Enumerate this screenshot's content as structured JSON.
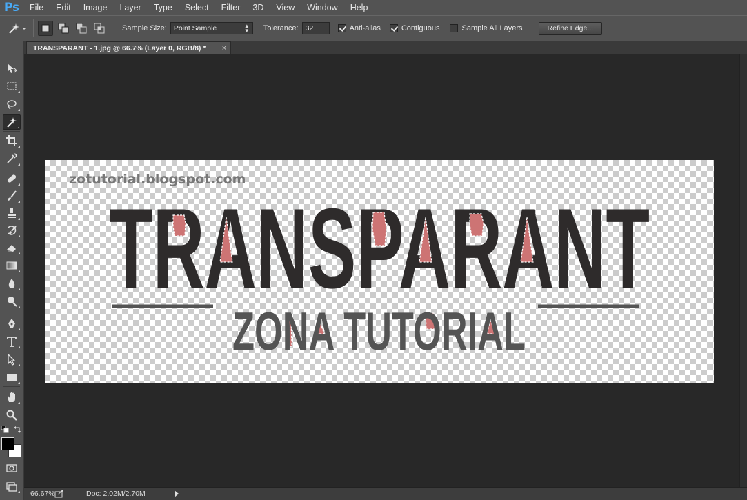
{
  "app": {
    "logo": "Ps"
  },
  "menu": [
    "File",
    "Edit",
    "Image",
    "Layer",
    "Type",
    "Select",
    "Filter",
    "3D",
    "View",
    "Window",
    "Help"
  ],
  "options": {
    "tool_icon": "magic-wand-icon",
    "selection_modes": [
      "new-selection-icon",
      "add-to-selection-icon",
      "subtract-from-selection-icon",
      "intersect-selection-icon"
    ],
    "sample_size_label": "Sample Size:",
    "sample_size_value": "Point Sample",
    "tolerance_label": "Tolerance:",
    "tolerance_value": "32",
    "anti_alias_label": "Anti-alias",
    "anti_alias_checked": true,
    "contiguous_label": "Contiguous",
    "contiguous_checked": true,
    "sample_all_layers_label": "Sample All Layers",
    "sample_all_layers_checked": false,
    "refine_edge_label": "Refine Edge..."
  },
  "document": {
    "tab_title": "TRANSPARANT - 1.jpg @ 66.7% (Layer 0, RGB/8) *",
    "tab_close": "×"
  },
  "artwork": {
    "watermark": "zotutorial.blogspot.com",
    "headline": "TRANSPARANT",
    "subline": "ZONA TUTORIAL",
    "headline_color": "#2e2b2b",
    "subline_color": "#545454",
    "selection_fill": "#cd7474"
  },
  "tools": [
    "move-icon",
    "marquee-icon",
    "lasso-icon",
    "magic-wand-icon",
    "crop-icon",
    "eyedropper-icon",
    "healing-brush-icon",
    "brush-icon",
    "clone-stamp-icon",
    "history-brush-icon",
    "eraser-icon",
    "gradient-icon",
    "blur-icon",
    "dodge-icon",
    "pen-icon",
    "type-icon",
    "path-selection-icon",
    "rectangle-icon",
    "hand-icon",
    "zoom-icon"
  ],
  "status": {
    "zoom": "66.67%",
    "doc_info": "Doc: 2.02M/2.70M"
  },
  "colors": {
    "foreground": "#000000",
    "background": "#ffffff"
  }
}
